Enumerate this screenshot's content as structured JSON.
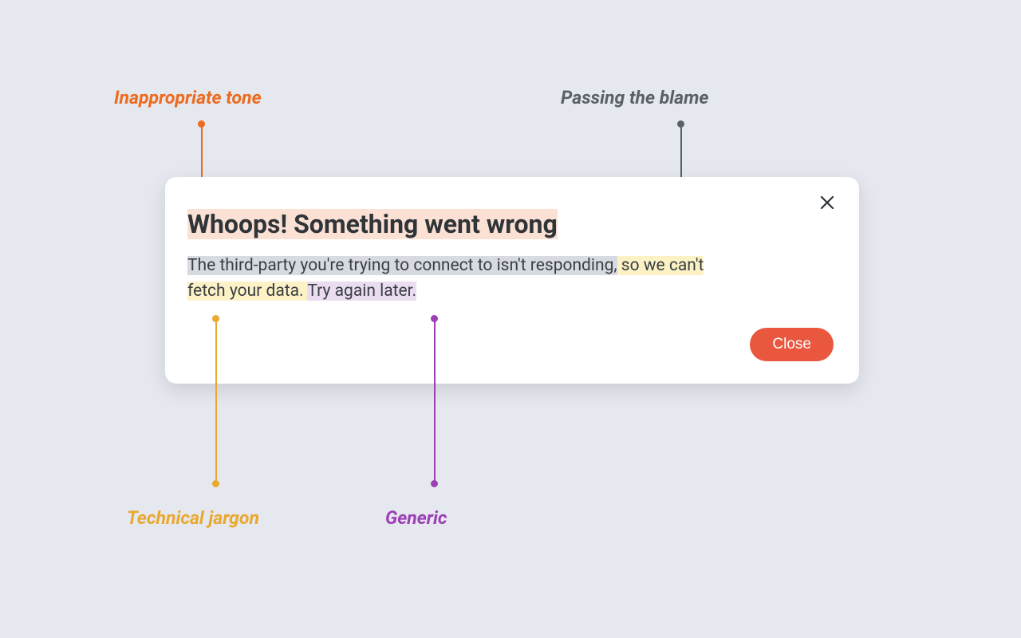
{
  "annotations": {
    "tone": {
      "label": "Inappropriate tone",
      "color": "#EC6B1E"
    },
    "blame": {
      "label": "Passing the blame",
      "color": "#5A6068"
    },
    "jargon": {
      "label": "Technical jargon",
      "color": "#E9A82E"
    },
    "generic": {
      "label": "Generic",
      "color": "#9C3FB5"
    }
  },
  "dialog": {
    "title": "Whoops! Something went wrong",
    "body_parts": {
      "blame": "The third-party you're trying to connect to isn't responding,",
      "jargon1": " so we can't ",
      "jargon2": "fetch your data. ",
      "generic": "Try again later."
    },
    "close_button": "Close"
  }
}
